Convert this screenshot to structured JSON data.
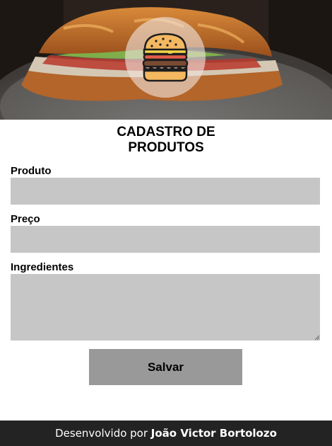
{
  "header": {
    "title_line1": "CADASTRO DE",
    "title_line2": "PRODUTOS",
    "logo_icon": "burger-icon"
  },
  "form": {
    "produto_label": "Produto",
    "produto_value": "",
    "preco_label": "Preço",
    "preco_value": "",
    "ingredientes_label": "Ingredientes",
    "ingredientes_value": "",
    "save_label": "Salvar"
  },
  "footer": {
    "prefix": "Desenvolvido por",
    "author": "João Victor Bortolozo"
  },
  "colors": {
    "field_bg": "#c6c6c6",
    "button_bg": "#999999",
    "footer_bg": "#232323"
  }
}
